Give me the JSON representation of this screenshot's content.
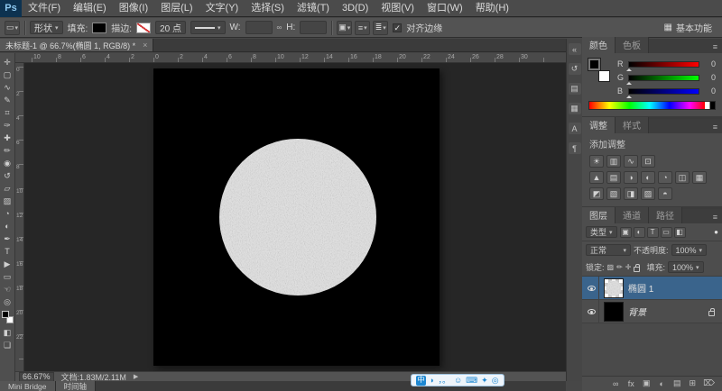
{
  "colors": {
    "accent_blue": "#2399e5",
    "selected_layer_bg": "#3a648c",
    "panel_bg": "#4d4d4d",
    "canvas_color": "#000000",
    "circle_color": "#e2e2e2"
  },
  "menu_bar": {
    "logo": "Ps",
    "items": [
      "文件(F)",
      "编辑(E)",
      "图像(I)",
      "图层(L)",
      "文字(Y)",
      "选择(S)",
      "滤镜(T)",
      "3D(D)",
      "视图(V)",
      "窗口(W)",
      "帮助(H)"
    ]
  },
  "options_bar": {
    "tool_preset_icon": "▭",
    "mode_value": "形状",
    "fill_label": "填充:",
    "stroke_label": "描边:",
    "stroke_size": "20 点",
    "w_label": "W:",
    "w_value": "",
    "h_label": "H:",
    "h_value": "",
    "path_icons": [
      {
        "name": "path-operations-icon",
        "glyph": "▣"
      },
      {
        "name": "path-alignment-icon",
        "glyph": "≡"
      },
      {
        "name": "path-arrange-icon",
        "glyph": "≣"
      }
    ],
    "align_edges_label": "对齐边缘",
    "checkbox_mark": "✓",
    "workspace_icon": "▦",
    "workspace_label": "基本功能"
  },
  "document_tab": {
    "title": "未标题-1 @ 66.7%(椭圆 1, RGB/8) *",
    "close": "×"
  },
  "rulers": {
    "horizontal": [
      "10",
      "8",
      "6",
      "4",
      "2",
      "0",
      "2",
      "4",
      "6",
      "8",
      "10",
      "12",
      "14",
      "16",
      "18",
      "20",
      "22",
      "24",
      "26",
      "28",
      "30"
    ],
    "vertical": [
      "0",
      "2",
      "4",
      "6",
      "8",
      "10",
      "12",
      "14",
      "16",
      "18",
      "20",
      "22"
    ]
  },
  "tools": [
    {
      "name": "move-tool",
      "glyph": "✛"
    },
    {
      "name": "marquee-tool",
      "glyph": "▢"
    },
    {
      "name": "lasso-tool",
      "glyph": "∿"
    },
    {
      "name": "quick-selection-tool",
      "glyph": "✎"
    },
    {
      "name": "crop-tool",
      "glyph": "⌗"
    },
    {
      "name": "eyedropper-tool",
      "glyph": "✑"
    },
    {
      "name": "healing-brush-tool",
      "glyph": "✚"
    },
    {
      "name": "brush-tool",
      "glyph": "✏"
    },
    {
      "name": "clone-stamp-tool",
      "glyph": "◉"
    },
    {
      "name": "history-brush-tool",
      "glyph": "↺"
    },
    {
      "name": "eraser-tool",
      "glyph": "▱"
    },
    {
      "name": "gradient-tool",
      "glyph": "▨"
    },
    {
      "name": "blur-tool",
      "glyph": "◔"
    },
    {
      "name": "dodge-tool",
      "glyph": "◐"
    },
    {
      "name": "pen-tool",
      "glyph": "✒"
    },
    {
      "name": "type-tool",
      "glyph": "T"
    },
    {
      "name": "path-selection-tool",
      "glyph": "▶"
    },
    {
      "name": "shape-tool",
      "glyph": "▭"
    },
    {
      "name": "hand-tool",
      "glyph": "☜"
    },
    {
      "name": "zoom-tool",
      "glyph": "◎"
    }
  ],
  "toolbar_extra": {
    "quick_mask": "◧",
    "screen_mode": "❏"
  },
  "color_panel": {
    "tabs": [
      "颜色",
      "色板"
    ],
    "sliders": [
      {
        "label": "R",
        "value": "0",
        "gradient": "red"
      },
      {
        "label": "G",
        "value": "0",
        "gradient": "green"
      },
      {
        "label": "B",
        "value": "0",
        "gradient": "blue"
      }
    ]
  },
  "adjustments_panel": {
    "tabs": [
      "调整",
      "样式"
    ],
    "title": "添加调整",
    "rows": [
      [
        {
          "name": "brightness-contrast-icon",
          "glyph": "☀"
        },
        {
          "name": "levels-icon",
          "glyph": "▥"
        },
        {
          "name": "curves-icon",
          "glyph": "∿"
        },
        {
          "name": "exposure-icon",
          "glyph": "⊡"
        }
      ],
      [
        {
          "name": "vibrance-icon",
          "glyph": "▲"
        },
        {
          "name": "hue-saturation-icon",
          "glyph": "▤"
        },
        {
          "name": "color-balance-icon",
          "glyph": "◑"
        },
        {
          "name": "black-white-icon",
          "glyph": "◐"
        },
        {
          "name": "photo-filter-icon",
          "glyph": "◔"
        },
        {
          "name": "channel-mixer-icon",
          "glyph": "◫"
        },
        {
          "name": "color-lookup-icon",
          "glyph": "▦"
        }
      ],
      [
        {
          "name": "invert-icon",
          "glyph": "◩"
        },
        {
          "name": "posterize-icon",
          "glyph": "▧"
        },
        {
          "name": "threshold-icon",
          "glyph": "◨"
        },
        {
          "name": "gradient-map-icon",
          "glyph": "▨"
        },
        {
          "name": "selective-color-icon",
          "glyph": "◓"
        }
      ]
    ]
  },
  "layers_panel": {
    "tabs": [
      "图层",
      "通道",
      "路径"
    ],
    "filter_label": "类型",
    "filter_icons": [
      {
        "name": "filter-pixel-layers-icon",
        "glyph": "▣"
      },
      {
        "name": "filter-adjustment-layers-icon",
        "glyph": "◐"
      },
      {
        "name": "filter-type-layers-icon",
        "glyph": "T"
      },
      {
        "name": "filter-shape-layers-icon",
        "glyph": "▭"
      },
      {
        "name": "filter-smart-objects-icon",
        "glyph": "◧"
      }
    ],
    "blend_mode": "正常",
    "opacity_label": "不透明度:",
    "opacity_value": "100%",
    "lock_label": "锁定:",
    "fill_label": "填充:",
    "fill_value": "100%",
    "layers": [
      {
        "name": "椭圆 1"
      },
      {
        "name": "背景"
      }
    ],
    "bottom_icons": [
      {
        "name": "link-layers-icon",
        "glyph": "∞"
      },
      {
        "name": "layer-style-icon",
        "glyph": "fx"
      },
      {
        "name": "layer-mask-icon",
        "glyph": "▣"
      },
      {
        "name": "adjustment-layer-icon",
        "glyph": "◐"
      },
      {
        "name": "layer-group-icon",
        "glyph": "▤"
      },
      {
        "name": "new-layer-icon",
        "glyph": "⊞"
      },
      {
        "name": "delete-layer-icon",
        "glyph": "⌦"
      }
    ]
  },
  "dock_icons": [
    {
      "name": "collapse-dock-icon",
      "glyph": "«"
    },
    {
      "name": "history-panel-icon",
      "glyph": "↺"
    },
    {
      "name": "properties-panel-icon",
      "glyph": "▤"
    },
    {
      "name": "info-panel-icon",
      "glyph": "▦"
    },
    {
      "name": "character-panel-icon",
      "glyph": "A"
    },
    {
      "name": "paragraph-panel-icon",
      "glyph": "¶"
    }
  ],
  "status_bar": {
    "zoom": "66.67%",
    "doc_info": "文档:1.83M/2.11M",
    "arrow": "▶"
  },
  "bottom_tabs": [
    "Mini Bridge",
    "时间轴"
  ],
  "ime_bar": {
    "icons": [
      {
        "name": "ime-mode-icon",
        "glyph": "中"
      },
      {
        "name": "ime-fullwidth-icon",
        "glyph": "◗"
      },
      {
        "name": "ime-punctuation-icon",
        "glyph": "，。"
      },
      {
        "name": "ime-emoji-icon",
        "glyph": "☺"
      },
      {
        "name": "ime-keyboard-icon",
        "glyph": "⌨"
      },
      {
        "name": "ime-toolbox-icon",
        "glyph": "✦"
      },
      {
        "name": "ime-search-icon",
        "glyph": "◎"
      }
    ]
  }
}
